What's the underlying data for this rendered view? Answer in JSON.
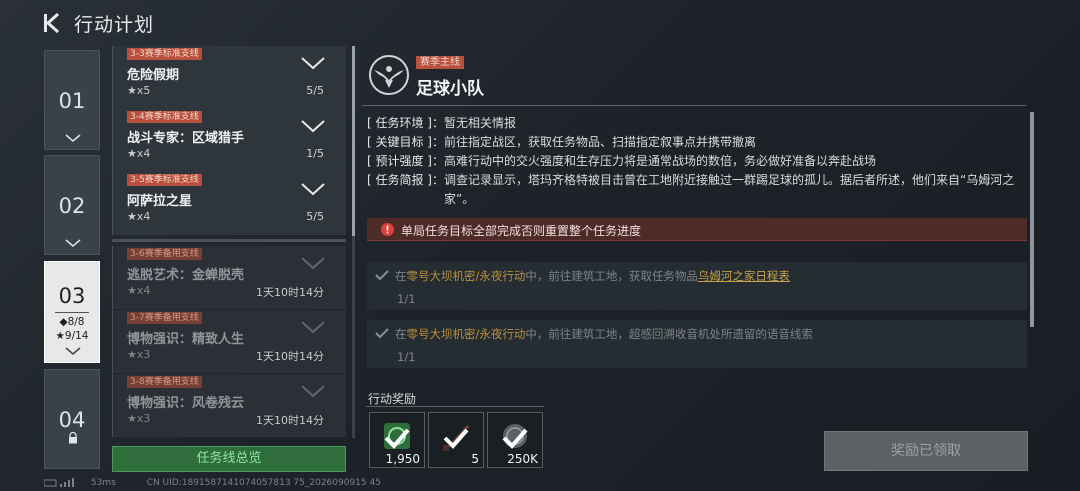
{
  "header": {
    "title": "行动计划"
  },
  "chapters": [
    {
      "num": "01"
    },
    {
      "num": "02"
    },
    {
      "num": "03",
      "stat1": "◆8/8",
      "stat2": "★9/14"
    },
    {
      "num": "04"
    }
  ],
  "quests": [
    {
      "tag": "3-3赛季标准支线",
      "name": "危险假期",
      "stars": "★x5",
      "progress": "5/5"
    },
    {
      "tag": "3-4赛季标准支线",
      "name": "战斗专家：区域猎手",
      "stars": "★x4",
      "progress": "1/5"
    },
    {
      "tag": "3-5赛季标准支线",
      "name": "阿萨拉之星",
      "stars": "★x4",
      "progress": "5/5"
    },
    {
      "tag": "3-6赛季备用支线",
      "name": "逃脱艺术：金蝉脱壳",
      "stars": "★x4",
      "progress": "1天10时14分"
    },
    {
      "tag": "3-7赛季备用支线",
      "name": "博物强识：精致人生",
      "stars": "★x3",
      "progress": "1天10时14分"
    },
    {
      "tag": "3-8赛季备用支线",
      "name": "博物强识：风卷残云",
      "stars": "★x3",
      "progress": "1天10时14分"
    }
  ],
  "overview_button": "任务线总览",
  "detail": {
    "tag": "赛季主线",
    "title": "足球小队",
    "info": [
      {
        "label": "[ 任务环境 ]：",
        "text": "暂无相关情报"
      },
      {
        "label": "[ 关键目标 ]：",
        "text": "前往指定战区，获取任务物品、扫描指定叙事点并携带撤离"
      },
      {
        "label": "[ 预计强度 ]：",
        "text": "高难行动中的交火强度和生存压力将是通常战场的数倍，务必做好准备以奔赴战场"
      },
      {
        "label": "[ 任务简报 ]：",
        "text": "调查记录显示，塔玛齐格特被目击曾在工地附近接触过一群踢足球的孤儿。据后者所述，他们来自“乌姆河之家”。"
      }
    ],
    "warning": "单局任务目标全部完成否则重置整个任务进度",
    "objectives": [
      {
        "pre": "在",
        "place": "零号大坝机密/永夜行动",
        "mid": "中，前往建筑工地，获取任务物品",
        "item": "乌姆河之家日程表",
        "post": "",
        "count": "1/1"
      },
      {
        "pre": "在",
        "place": "零号大坝机密/永夜行动",
        "mid": "中，前往建筑工地，超感回溯收音机处所遗留的语音线索",
        "item": "",
        "post": "",
        "count": "1/1"
      }
    ]
  },
  "rewards": {
    "label": "行动奖励",
    "items": [
      {
        "icon": "coin-icon",
        "count": "1,950"
      },
      {
        "icon": "knife-icon",
        "count": "5"
      },
      {
        "icon": "cash-icon",
        "count": "250K"
      }
    ]
  },
  "claim_button": "奖励已领取",
  "status": {
    "ping": "53ms",
    "uid": "CN UID:1891587141074057813 75_2026090915 45"
  }
}
